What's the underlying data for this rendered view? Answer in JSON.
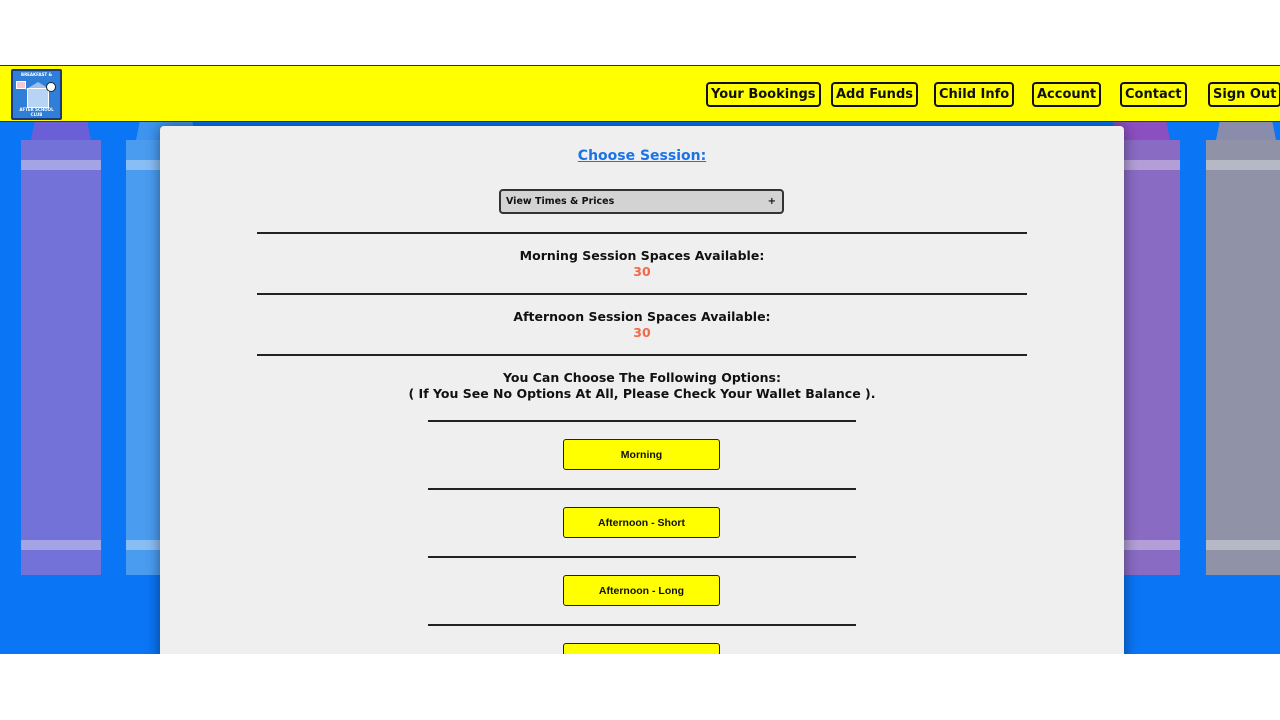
{
  "logo": {
    "top_text": "BREAKFAST &",
    "bottom_text": "AFTER SCHOOL CLUB"
  },
  "nav": {
    "your_bookings": "Your Bookings",
    "add_funds": "Add Funds",
    "child_info": "Child Info",
    "account": "Account",
    "contact": "Contact",
    "sign_out": "Sign Out"
  },
  "main": {
    "title": "Choose Session:",
    "times_toggle": {
      "label": "View Times & Prices",
      "icon": "+"
    },
    "morning_label": "Morning Session Spaces Available:",
    "morning_count": "30",
    "afternoon_label": "Afternoon Session Spaces Available:",
    "afternoon_count": "30",
    "options_heading": "You Can Choose The Following Options:",
    "options_note": "( If You See No Options At All, Please Check Your Wallet Balance ).",
    "options": [
      "Morning",
      "Afternoon - Short",
      "Afternoon - Long",
      ""
    ]
  },
  "colors": {
    "accent": "#ffff00",
    "background": "#0a75f5",
    "link": "#1a73e8",
    "count": "#f06a4a"
  }
}
